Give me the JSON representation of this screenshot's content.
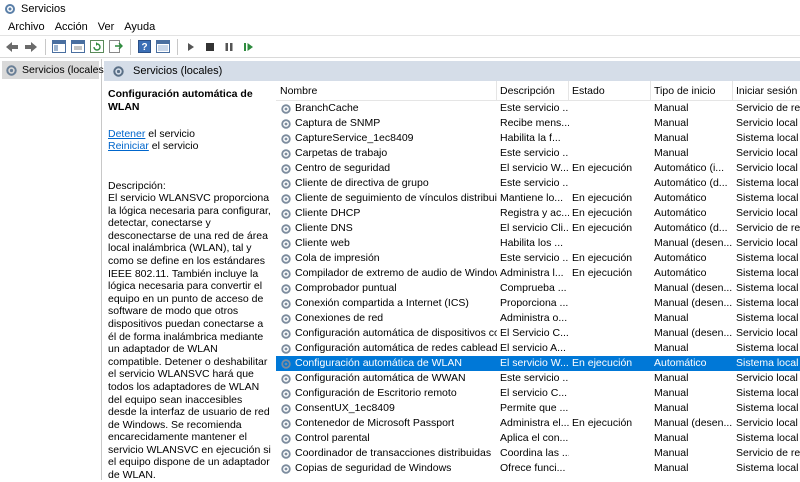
{
  "window": {
    "title": "Servicios"
  },
  "menu": [
    "Archivo",
    "Acción",
    "Ver",
    "Ayuda"
  ],
  "toolbar": {
    "icons": [
      "back-arrow-icon",
      "forward-arrow-icon",
      "console-tree-icon",
      "properties-icon",
      "refresh-icon",
      "export-list-icon",
      "help-icon",
      "mmc-view-icon",
      "play-icon",
      "stop-icon",
      "pause-icon",
      "resume-icon"
    ]
  },
  "tree": {
    "root_label": "Servicios (locales)"
  },
  "content": {
    "header_title": "Servicios (locales)",
    "selected_service": "Configuración automática de WLAN",
    "actions": [
      {
        "link": "Detener",
        "suffix": " el servicio"
      },
      {
        "link": "Reiniciar",
        "suffix": " el servicio"
      }
    ],
    "description_label": "Descripción:",
    "description": "El servicio WLANSVC proporciona la lógica necesaria para configurar, detectar, conectarse y desconectarse de una red de área local inalámbrica (WLAN), tal y como se define en los estándares IEEE 802.11. También incluye la lógica necesaria para convertir el equipo en un punto de acceso de software de modo que otros dispositivos puedan conectarse a él de forma inalámbrica mediante un adaptador de WLAN compatible. Detener o deshabilitar el servicio WLANSVC hará que todos los adaptadores de WLAN del equipo sean inaccesibles desde la interfaz de usuario de red de Windows. Se recomienda encarecidamente mantener el servicio WLANSVC en ejecución si el equipo dispone de un adaptador de WLAN."
  },
  "list": {
    "columns": [
      "Nombre",
      "Descripción",
      "Estado",
      "Tipo de inicio",
      "Iniciar sesión c"
    ],
    "rows": [
      {
        "name": "BranchCache",
        "desc": "Este servicio ...",
        "state": "",
        "start": "Manual",
        "logon": "Servicio de red"
      },
      {
        "name": "Captura de SNMP",
        "desc": "Recibe mens...",
        "state": "",
        "start": "Manual",
        "logon": "Servicio local"
      },
      {
        "name": "CaptureService_1ec8409",
        "desc": "Habilita la f...",
        "state": "",
        "start": "Manual",
        "logon": "Sistema local"
      },
      {
        "name": "Carpetas de trabajo",
        "desc": "Este servicio ...",
        "state": "",
        "start": "Manual",
        "logon": "Servicio local"
      },
      {
        "name": "Centro de seguridad",
        "desc": "El servicio W...",
        "state": "En ejecución",
        "start": "Automático (i...",
        "logon": "Servicio local"
      },
      {
        "name": "Cliente de directiva de grupo",
        "desc": "Este servicio ...",
        "state": "",
        "start": "Automático (d...",
        "logon": "Sistema local"
      },
      {
        "name": "Cliente de seguimiento de vínculos distribuid...",
        "desc": "Mantiene lo...",
        "state": "En ejecución",
        "start": "Automático",
        "logon": "Sistema local"
      },
      {
        "name": "Cliente DHCP",
        "desc": "Registra y ac...",
        "state": "En ejecución",
        "start": "Automático",
        "logon": "Servicio local"
      },
      {
        "name": "Cliente DNS",
        "desc": "El servicio Cli...",
        "state": "En ejecución",
        "start": "Automático (d...",
        "logon": "Servicio de red"
      },
      {
        "name": "Cliente web",
        "desc": "Habilita los ...",
        "state": "",
        "start": "Manual (desen...",
        "logon": "Servicio local"
      },
      {
        "name": "Cola de impresión",
        "desc": "Este servicio ...",
        "state": "En ejecución",
        "start": "Automático",
        "logon": "Sistema local"
      },
      {
        "name": "Compilador de extremo de audio de Windows",
        "desc": "Administra l...",
        "state": "En ejecución",
        "start": "Automático",
        "logon": "Sistema local"
      },
      {
        "name": "Comprobador puntual",
        "desc": "Comprueba ...",
        "state": "",
        "start": "Manual (desen...",
        "logon": "Sistema local"
      },
      {
        "name": "Conexión compartida a Internet (ICS)",
        "desc": "Proporciona ...",
        "state": "",
        "start": "Manual (desen...",
        "logon": "Sistema local"
      },
      {
        "name": "Conexiones de red",
        "desc": "Administra o...",
        "state": "",
        "start": "Manual",
        "logon": "Sistema local"
      },
      {
        "name": "Configuración automática de dispositivos co...",
        "desc": "El Servicio C...",
        "state": "",
        "start": "Manual (desen...",
        "logon": "Servicio local"
      },
      {
        "name": "Configuración automática de redes cableadas",
        "desc": "El servicio A...",
        "state": "",
        "start": "Manual",
        "logon": "Sistema local"
      },
      {
        "name": "Configuración automática de WLAN",
        "desc": "El servicio W...",
        "state": "En ejecución",
        "start": "Automático",
        "logon": "Sistema local",
        "selected": true
      },
      {
        "name": "Configuración automática de WWAN",
        "desc": "Este servicio ...",
        "state": "",
        "start": "Manual",
        "logon": "Servicio local"
      },
      {
        "name": "Configuración de Escritorio remoto",
        "desc": "El servicio C...",
        "state": "",
        "start": "Manual",
        "logon": "Sistema local"
      },
      {
        "name": "ConsentUX_1ec8409",
        "desc": "Permite que ...",
        "state": "",
        "start": "Manual",
        "logon": "Sistema local"
      },
      {
        "name": "Contenedor de Microsoft Passport",
        "desc": "Administra el...",
        "state": "En ejecución",
        "start": "Manual (desen...",
        "logon": "Servicio local"
      },
      {
        "name": "Control parental",
        "desc": "Aplica el con...",
        "state": "",
        "start": "Manual",
        "logon": "Sistema local"
      },
      {
        "name": "Coordinador de transacciones distribuidas",
        "desc": "Coordina las ...",
        "state": "",
        "start": "Manual",
        "logon": "Servicio de red"
      },
      {
        "name": "Copias de seguridad de Windows",
        "desc": "Ofrece funci...",
        "state": "",
        "start": "Manual",
        "logon": "Sistema local"
      }
    ]
  },
  "colors": {
    "selection": "#0078d7",
    "header_band": "#d5dde8",
    "link": "#0066cc"
  }
}
